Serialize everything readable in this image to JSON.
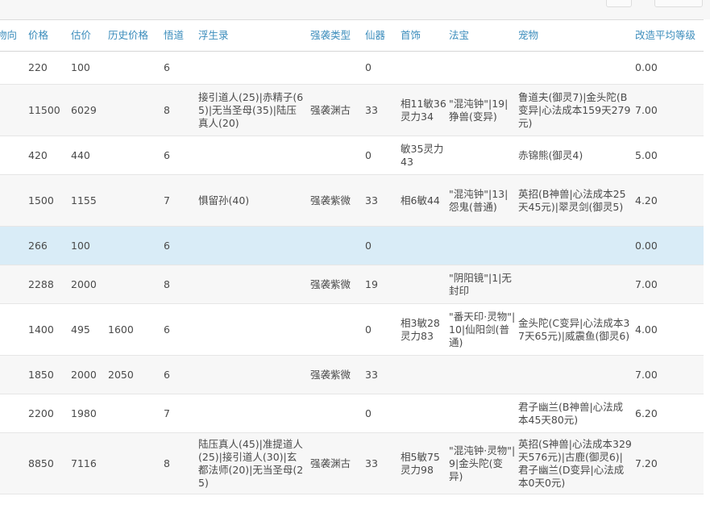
{
  "columns": [
    {
      "key": "c0",
      "label": "物向"
    },
    {
      "key": "c1",
      "label": "价格"
    },
    {
      "key": "c2",
      "label": "估价"
    },
    {
      "key": "c3",
      "label": "历史价格"
    },
    {
      "key": "c4",
      "label": "悟道"
    },
    {
      "key": "c5",
      "label": "浮生录"
    },
    {
      "key": "c6",
      "label": "强袭类型"
    },
    {
      "key": "c7",
      "label": "仙器"
    },
    {
      "key": "c8",
      "label": "首饰"
    },
    {
      "key": "c9",
      "label": "法宝"
    },
    {
      "key": "c10",
      "label": "宠物"
    },
    {
      "key": "c11",
      "label": "改造平均等级"
    }
  ],
  "rows": [
    {
      "c1": "220",
      "c2": "100",
      "c3": "",
      "c4": "6",
      "c5": "",
      "c6": "",
      "c7": "0",
      "c8": "",
      "c9": "",
      "c10": "",
      "c11": "0.00"
    },
    {
      "c1": "11500",
      "c2": "6029",
      "c3": "",
      "c4": "8",
      "c5": "接引道人(25)|赤精子(65)|无当圣母(35)|陆压真人(20)",
      "c6": "强袭渊古",
      "c7": "33",
      "c8": "相11敏36灵力34",
      "c9": "\"混沌钟\"|19|狰兽(变异)",
      "c10": "鲁道夫(御灵7)|金头陀(B变异|心法成本159天279元)",
      "c11": "7.00"
    },
    {
      "c1": "420",
      "c2": "440",
      "c3": "",
      "c4": "6",
      "c5": "",
      "c6": "",
      "c7": "0",
      "c8": "敏35灵力43",
      "c9": "",
      "c10": "赤锦熊(御灵4)",
      "c11": "5.00"
    },
    {
      "c1": "1500",
      "c2": "1155",
      "c3": "",
      "c4": "7",
      "c5": "惧留孙(40)",
      "c6": "强袭紫微",
      "c7": "33",
      "c8": "相6敏44",
      "c9": "\"混沌钟\"|13|怨鬼(普通)",
      "c10": "英招(B神兽|心法成本25天45元)|翠灵剑(御灵5)",
      "c11": "4.20"
    },
    {
      "c1": "266",
      "c2": "100",
      "c3": "",
      "c4": "6",
      "c5": "",
      "c6": "",
      "c7": "0",
      "c8": "",
      "c9": "",
      "c10": "",
      "c11": "0.00"
    },
    {
      "c1": "2288",
      "c2": "2000",
      "c3": "",
      "c4": "8",
      "c5": "",
      "c6": "强袭紫微",
      "c7": "19",
      "c8": "",
      "c9": "\"阴阳镜\"|1|无封印",
      "c10": "",
      "c11": "7.00"
    },
    {
      "c1": "1400",
      "c2": "495",
      "c3": "1600",
      "c4": "6",
      "c5": "",
      "c6": "",
      "c7": "0",
      "c8": "相3敏28灵力83",
      "c9": "\"番天印·灵物\"|10|仙阳剑(普通)",
      "c10": "金头陀(C变异|心法成本37天65元)|威震鱼(御灵6)",
      "c11": "4.00"
    },
    {
      "c1": "1850",
      "c2": "2000",
      "c3": "2050",
      "c4": "6",
      "c5": "",
      "c6": "强袭紫微",
      "c7": "33",
      "c8": "",
      "c9": "",
      "c10": "",
      "c11": "7.00"
    },
    {
      "c1": "2200",
      "c2": "1980",
      "c3": "",
      "c4": "7",
      "c5": "",
      "c6": "",
      "c7": "0",
      "c8": "",
      "c9": "",
      "c10": "君子幽兰(B神兽|心法成本45天80元)",
      "c11": "6.20"
    },
    {
      "c1": "8850",
      "c2": "7116",
      "c3": "",
      "c4": "8",
      "c5": "陆压真人(45)|准提道人(25)|接引道人(30)|玄都法师(20)|无当圣母(25)",
      "c6": "强袭渊古",
      "c7": "33",
      "c8": "相5敏75灵力98",
      "c9": "\"混沌钟·灵物\"|9|金头陀(变异)",
      "c10": "英招(S神兽|心法成本329天576元)|古鹿(御灵6)|君子幽兰(D变异|心法成本0天0元)",
      "c11": "7.20"
    }
  ]
}
